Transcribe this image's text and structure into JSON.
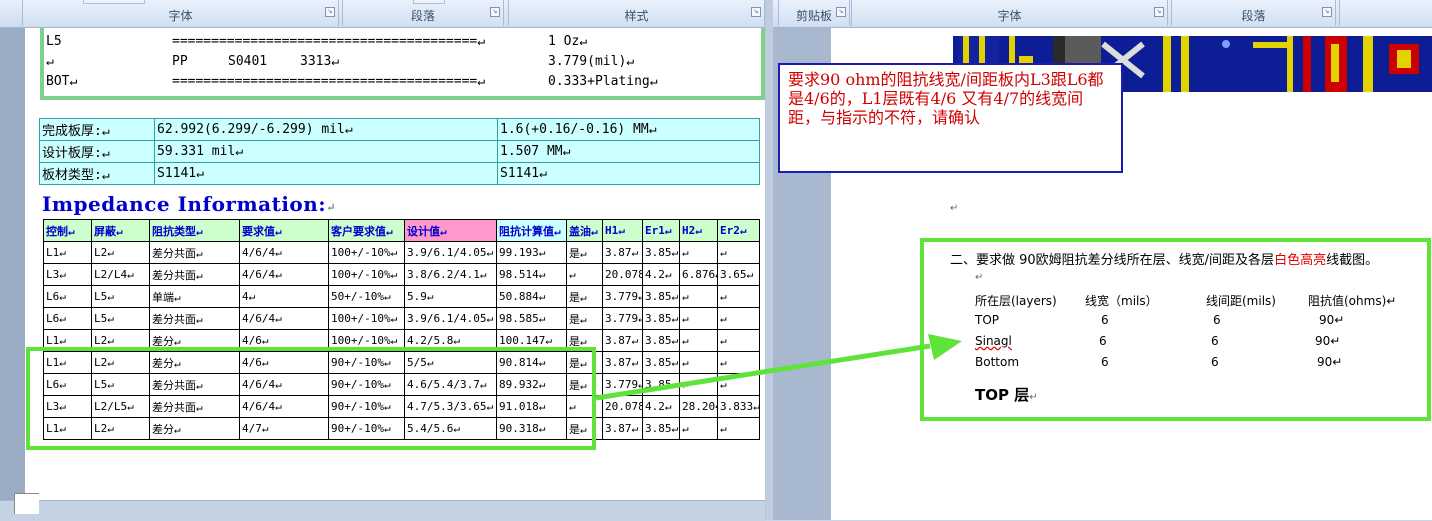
{
  "left_ribbon": {
    "groups": [
      "字体",
      "段落",
      "样式"
    ],
    "launcher_glyph": "↘"
  },
  "right_ribbon": {
    "groups": [
      "剪贴板",
      "字体",
      "段落"
    ],
    "launcher_glyph": "↘"
  },
  "stackup": {
    "rows": [
      {
        "layer": "L5",
        "type": "",
        "material": "",
        "thickness": "",
        "line": "=======================================↵",
        "value": "1 Oz↵"
      },
      {
        "layer": "↵",
        "type": "PP",
        "material": "S0401",
        "thickness": "3313↵",
        "line": "",
        "value": "3.779(mil)↵"
      },
      {
        "layer": "BOT↵",
        "type": "",
        "material": "",
        "thickness": "",
        "line": "=======================================↵",
        "value": "0.333+Plating↵"
      }
    ]
  },
  "board_info": {
    "rows": [
      {
        "label": "完成板厚:↵",
        "v1": "62.992(6.299/-6.299) mil↵",
        "v2": "1.6(+0.16/-0.16) MM↵"
      },
      {
        "label": "设计板厚:↵",
        "v1": "59.331 mil↵",
        "v2": "1.507 MM↵"
      },
      {
        "label": "板材类型:↵",
        "v1": "S1141↵",
        "v2": "S1141↵"
      }
    ]
  },
  "impedance": {
    "title": "Impedance Information:",
    "title_mark": "↵",
    "headers": [
      "控制↵",
      "屏蔽↵",
      "阻抗类型↵",
      "要求值↵",
      "客户要求值↵",
      "设计值↵",
      "阻抗计算值↵",
      "盖油↵",
      "H1↵",
      "Er1↵",
      "H2↵",
      "Er2↵"
    ],
    "rows": [
      [
        "L1↵",
        "L2↵",
        "差分共面↵",
        "4/6/4↵",
        "100+/-10%↵",
        "3.9/6.1/4.05↵",
        "99.193↵",
        "是↵",
        "3.87↵",
        "3.85↵",
        "↵",
        "↵"
      ],
      [
        "L3↵",
        "L2/L4↵",
        "差分共面↵",
        "4/6/4↵",
        "100+/-10%↵",
        "3.8/6.2/4.1↵",
        "98.514↵",
        "↵",
        "20.078↵",
        "4.2↵",
        "6.876↵",
        "3.65↵"
      ],
      [
        "L6↵",
        "L5↵",
        "单端↵",
        "4↵",
        "50+/-10%↵",
        "5.9↵",
        "50.884↵",
        "是↵",
        "3.779↵",
        "3.85↵",
        "↵",
        "↵"
      ],
      [
        "L6↵",
        "L5↵",
        "差分共面↵",
        "4/6/4↵",
        "100+/-10%↵",
        "3.9/6.1/4.05↵",
        "98.585↵",
        "是↵",
        "3.779↵",
        "3.85↵",
        "↵",
        "↵"
      ],
      [
        "L1↵",
        "L2↵",
        "差分↵",
        "4/6↵",
        "100+/-10%↵",
        "4.2/5.8↵",
        "100.147↵",
        "是↵",
        "3.87↵",
        "3.85↵",
        "↵",
        "↵"
      ],
      [
        "L1↵",
        "L2↵",
        "差分↵",
        "4/6↵",
        "90+/-10%↵",
        "5/5↵",
        "90.814↵",
        "是↵",
        "3.87↵",
        "3.85↵",
        "↵",
        "↵"
      ],
      [
        "L6↵",
        "L5↵",
        "差分共面↵",
        "4/6/4↵",
        "90+/-10%↵",
        "4.6/5.4/3.7↵",
        "89.932↵",
        "是↵",
        "3.779↵",
        "3.85↵",
        "↵",
        "↵"
      ],
      [
        "L3↵",
        "L2/L5↵",
        "差分共面↵",
        "4/6/4↵",
        "90+/-10%↵",
        "4.7/5.3/3.65↵",
        "91.018↵",
        "↵",
        "20.078↵",
        "4.2↵",
        "28.204↵",
        "3.833↵"
      ],
      [
        "L1↵",
        "L2↵",
        "差分↵",
        "4/7↵",
        "90+/-10%↵",
        "5.4/5.6↵",
        "90.318↵",
        "是↵",
        "3.87↵",
        "3.85↵",
        "↵",
        "↵"
      ]
    ]
  },
  "comment": {
    "text": "要求90 ohm的阻抗线宽/间距板内L3跟L6都是4/6的，L1层既有4/6 又有4/7的线宽间距，与指示的不符，请确认"
  },
  "requirement": {
    "pilcrow": "↵",
    "heading_pre": "二、要求做 90欧姆阻抗差分线所在层、线宽/间距及各层",
    "heading_red": "白色高亮",
    "heading_post": "线截图。",
    "blank_mark": "↵",
    "col_headers": [
      "所在层(layers)",
      "线宽（mils）",
      "线间距(mils)",
      "阻抗值(ohms)↵"
    ],
    "rows": [
      [
        "TOP",
        "6",
        "6",
        "90↵"
      ],
      [
        "Sinagl",
        "6",
        "6",
        "90↵"
      ],
      [
        "Bottom",
        "6",
        "6",
        "90↵"
      ]
    ],
    "sub_heading": "TOP 层",
    "sub_heading_mark": "↵"
  },
  "colors": {
    "highlight_green": "#5fe23a",
    "comment_border": "#1c1cb0",
    "comment_text": "#d00000",
    "impedance_title": "#0000cc"
  }
}
